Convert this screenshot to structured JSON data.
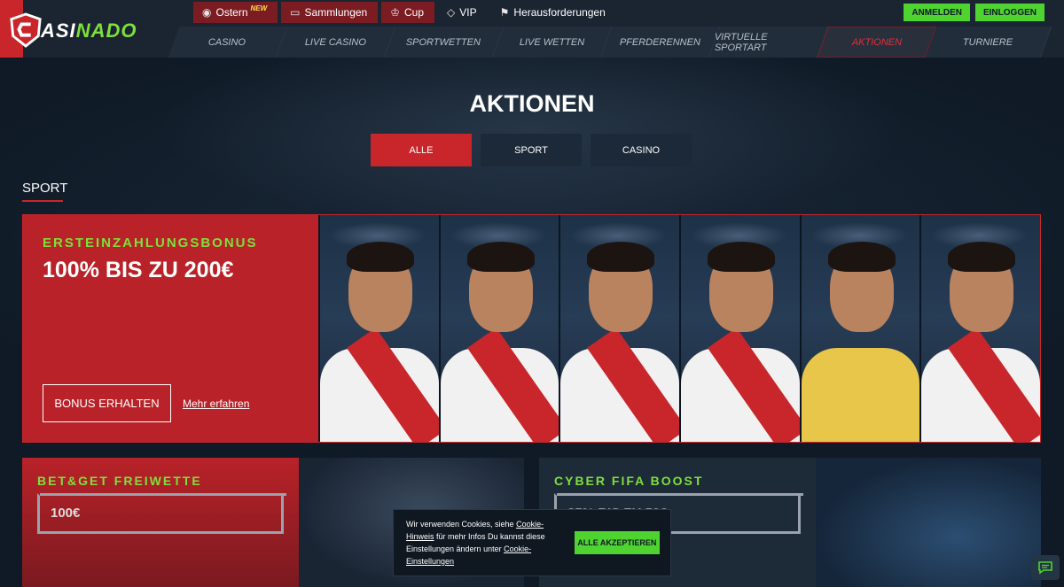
{
  "brand": {
    "logo_prefix": "C",
    "logo_mid": "ASI",
    "logo_accent": "NADO"
  },
  "top_links": [
    {
      "label": "Ostern",
      "badge": "NEW",
      "icon": "globe-icon",
      "highlight": true
    },
    {
      "label": "Sammlungen",
      "badge": "",
      "icon": "book-icon",
      "highlight": true
    },
    {
      "label": "Cup",
      "badge": "",
      "icon": "trophy-icon",
      "highlight": true
    },
    {
      "label": "VIP",
      "badge": "",
      "icon": "diamond-icon",
      "highlight": false
    },
    {
      "label": "Herausforderungen",
      "badge": "",
      "icon": "flag-icon",
      "highlight": false
    }
  ],
  "auth": {
    "login": "ANMELDEN",
    "register": "EINLOGGEN"
  },
  "nav": [
    {
      "label": "CASINO"
    },
    {
      "label": "LIVE CASINO"
    },
    {
      "label": "SPORTWETTEN"
    },
    {
      "label": "LIVE WETTEN"
    },
    {
      "label": "PFERDERENNEN"
    },
    {
      "label": "VIRTUELLE SPORTART"
    },
    {
      "label": "AKTIONEN"
    },
    {
      "label": "TURNIERE"
    }
  ],
  "page": {
    "title": "AKTIONEN"
  },
  "filters": [
    {
      "label": "ALLE"
    },
    {
      "label": "SPORT"
    },
    {
      "label": "CASINO"
    }
  ],
  "section": {
    "title": "SPORT"
  },
  "promo": {
    "kicker": "ERSTEINZAHLUNGSBONUS",
    "headline": "100% BIS ZU 200€",
    "cta": "BONUS ERHALTEN",
    "more": "Mehr erfahren"
  },
  "cards": [
    {
      "kicker": "BET&GET FREIWETTE",
      "value": "100€"
    },
    {
      "kicker": "CYBER FIFA BOOST",
      "value": "25% BIS ZU 50€"
    }
  ],
  "cookie": {
    "text_1": "Wir verwenden Cookies, siehe",
    "link_1": "Cookie-Hinweis",
    "text_2": "für mehr Infos Du kannst diese Einstellungen ändern unter",
    "link_2": "Cookie-Einstellungen",
    "accept": "ALLE AKZEPTIEREN"
  },
  "colors": {
    "accent_red": "#c8262b",
    "accent_green": "#7ee03b",
    "button_green": "#4fd330",
    "bg": "#0f1a26"
  }
}
